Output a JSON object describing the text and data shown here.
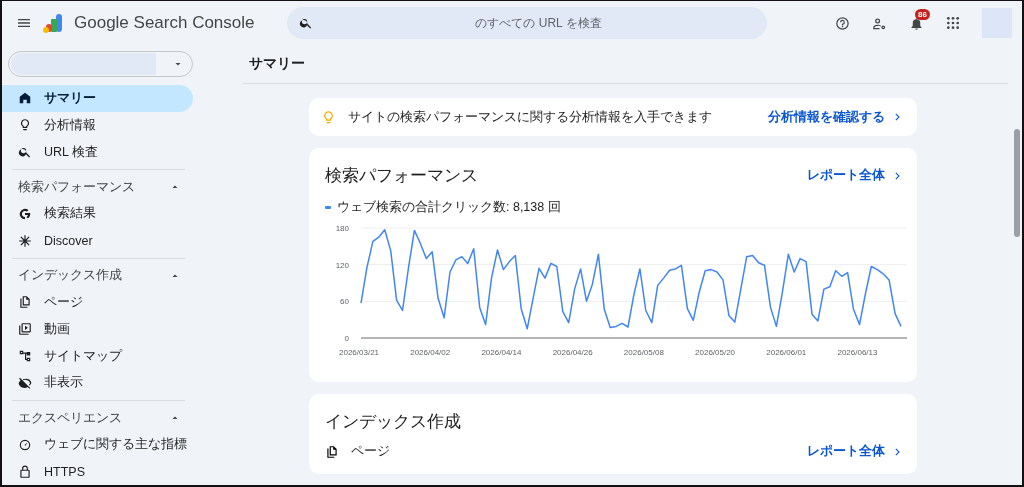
{
  "app": {
    "title": "Google Search Console"
  },
  "search": {
    "placeholder": "のすべての URL を検査"
  },
  "header_actions": {
    "notification_count": "86"
  },
  "sidebar": {
    "top_items": [
      {
        "label": "サマリー",
        "selected": true
      },
      {
        "label": "分析情報",
        "selected": false
      },
      {
        "label": "URL 検査",
        "selected": false
      }
    ],
    "sections": [
      {
        "title": "検索パフォーマンス",
        "expanded": true,
        "items": [
          {
            "label": "検索結果",
            "selected": false
          },
          {
            "label": "Discover",
            "selected": false
          }
        ]
      },
      {
        "title": "インデックス作成",
        "expanded": true,
        "items": [
          {
            "label": "ページ",
            "selected": false
          },
          {
            "label": "動画",
            "selected": false
          },
          {
            "label": "サイトマップ",
            "selected": false
          },
          {
            "label": "非表示",
            "selected": false
          }
        ]
      },
      {
        "title": "エクスペリエンス",
        "expanded": true,
        "items": [
          {
            "label": "ウェブに関する主な指標",
            "selected": false
          },
          {
            "label": "HTTPS",
            "selected": false
          }
        ]
      }
    ]
  },
  "page_title": "サマリー",
  "insight_banner": {
    "text": "サイトの検索パフォーマンスに関する分析情報を入手できます",
    "link": "分析情報を確認する"
  },
  "performance_card": {
    "title": "検索パフォーマンス",
    "link": "レポート全体",
    "legend": "ウェブ検索の合計クリック数: 8,138 回",
    "chart_data": {
      "type": "line",
      "ylim": [
        0,
        180
      ],
      "yticks": [
        0,
        60,
        120,
        180
      ],
      "categories": [
        "2026/03/21",
        null,
        null,
        null,
        null,
        null,
        null,
        null,
        null,
        null,
        null,
        null,
        "2026/04/02",
        null,
        null,
        null,
        null,
        null,
        null,
        null,
        null,
        null,
        null,
        null,
        "2026/04/14",
        null,
        null,
        null,
        null,
        null,
        null,
        null,
        null,
        null,
        null,
        null,
        "2026/04/26",
        null,
        null,
        null,
        null,
        null,
        null,
        null,
        null,
        null,
        null,
        null,
        "2026/05/08",
        null,
        null,
        null,
        null,
        null,
        null,
        null,
        null,
        null,
        null,
        null,
        "2026/05/20",
        null,
        null,
        null,
        null,
        null,
        null,
        null,
        null,
        null,
        null,
        null,
        "2026/06/01",
        null,
        null,
        null,
        null,
        null,
        null,
        null,
        null,
        null,
        null,
        null,
        "2026/06/13",
        null,
        null,
        null,
        null,
        null,
        null,
        null
      ],
      "series": [
        {
          "color": "#4285f4",
          "values": [
            57,
            115,
            158,
            165,
            177,
            143,
            62,
            45,
            115,
            176,
            155,
            130,
            141,
            65,
            33,
            108,
            128,
            133,
            122,
            146,
            50,
            22,
            98,
            144,
            112,
            125,
            135,
            48,
            15,
            65,
            114,
            98,
            122,
            117,
            43,
            25,
            80,
            113,
            60,
            88,
            137,
            47,
            17,
            19,
            24,
            18,
            72,
            113,
            45,
            25,
            86,
            98,
            111,
            113,
            119,
            48,
            29,
            75,
            110,
            112,
            108,
            95,
            37,
            26,
            80,
            133,
            135,
            123,
            119,
            50,
            19,
            74,
            137,
            108,
            130,
            125,
            39,
            28,
            80,
            84,
            110,
            101,
            107,
            47,
            22,
            72,
            117,
            112,
            105,
            95,
            40,
            19
          ]
        }
      ]
    }
  },
  "index_card": {
    "title": "インデックス作成",
    "row_label": "ページ",
    "link": "レポート全体"
  }
}
